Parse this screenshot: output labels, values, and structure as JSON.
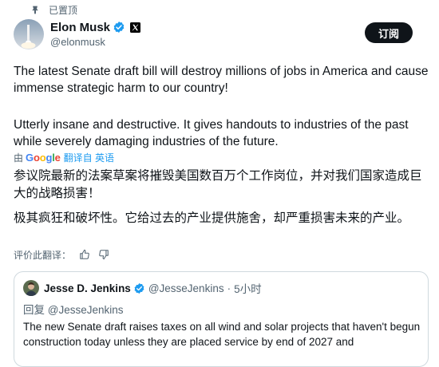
{
  "pinned": {
    "label": "已置顶",
    "icon": "pin-icon"
  },
  "author": {
    "name": "Elon Musk",
    "handle": "@elonmusk",
    "verified_color": "#1d9bf0"
  },
  "subscribe_label": "订阅",
  "tweet": {
    "paragraph1": "The latest Senate draft bill will destroy millions of jobs in America and cause immense strategic harm to our country!",
    "paragraph2": "Utterly insane and destructive. It gives handouts to industries of the past while severely damaging industries of the future."
  },
  "translation": {
    "by": "由",
    "provider": "Google",
    "translated_from": "翻译自 英语",
    "zh_paragraph1": "参议院最新的法案草案将摧毁美国数百万个工作岗位，并对我们国家造成巨大的战略损害！",
    "zh_paragraph2": "极其疯狂和破坏性。它给过去的产业提供施舍，却严重损害未来的产业。",
    "rate_label": "评价此翻译："
  },
  "quote": {
    "name": "Jesse D. Jenkins",
    "handle": "@JesseJenkins",
    "separator": "·",
    "time": "5小时",
    "reply_to": "回复 @JesseJenkins",
    "body": "The new Senate draft raises taxes on all wind and solar projects that haven't begun construction today unless they are placed service by end of 2027 and"
  }
}
